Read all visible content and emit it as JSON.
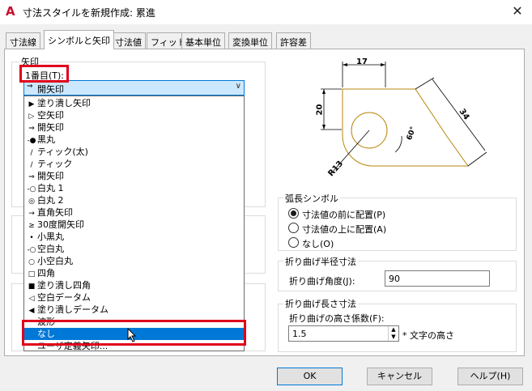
{
  "window": {
    "title": "寸法スタイルを新規作成: 累進",
    "app_icon": "A"
  },
  "tabs": [
    "寸法線",
    "シンボルと矢印",
    "寸法値",
    "フィット",
    "基本単位",
    "変換単位",
    "許容差"
  ],
  "arrows_group": {
    "label": "矢印",
    "first_label": "1番目(T):",
    "first_value": "開矢印"
  },
  "dropdown_items": [
    {
      "glyph": "▶",
      "label": "塗り潰し矢印"
    },
    {
      "glyph": "▷",
      "label": "空矢印"
    },
    {
      "glyph": "⇒",
      "label": "開矢印"
    },
    {
      "glyph": "-●",
      "label": "黒丸"
    },
    {
      "glyph": "/",
      "label": "ティック(太)"
    },
    {
      "glyph": "/",
      "label": "ティック"
    },
    {
      "glyph": "⇒",
      "label": "開矢印"
    },
    {
      "glyph": "-○",
      "label": "白丸 1"
    },
    {
      "glyph": "◎",
      "label": "白丸 2"
    },
    {
      "glyph": "→",
      "label": "直角矢印"
    },
    {
      "glyph": "≥",
      "label": "30度開矢印"
    },
    {
      "glyph": "•",
      "label": "小黒丸"
    },
    {
      "glyph": "-○",
      "label": "空白丸"
    },
    {
      "glyph": "○",
      "label": "小空白丸"
    },
    {
      "glyph": "□",
      "label": "四角"
    },
    {
      "glyph": "■",
      "label": "塗り潰し四角"
    },
    {
      "glyph": "◁",
      "label": "空白データム"
    },
    {
      "glyph": "◀",
      "label": "塗り潰しデータム"
    },
    {
      "glyph": "",
      "label": "波形"
    },
    {
      "glyph": "",
      "label": "なし"
    },
    {
      "glyph": "",
      "label": "ユーザ定義矢印..."
    }
  ],
  "dropdown_selected_index": 19,
  "drawing": {
    "dim_top": "17",
    "dim_left": "20",
    "dim_diag": "34",
    "dim_radius": "R13",
    "dim_angle": "60°"
  },
  "arc_symbol": {
    "label": "弧長シンボル",
    "options": [
      "寸法値の前に配置(P)",
      "寸法値の上に配置(A)",
      "なし(O)"
    ],
    "selected": 0
  },
  "jog_radius": {
    "label": "折り曲げ半径寸法",
    "angle_label": "折り曲げ角度(J):",
    "angle_value": "90"
  },
  "jog_linear": {
    "label": "折り曲げ長さ寸法",
    "height_label": "折り曲げの高さ係数(F):",
    "height_value": "1.5",
    "suffix": "* 文字の高さ"
  },
  "buttons": {
    "ok": "OK",
    "cancel": "キャンセル",
    "help": "ヘルプ(H)"
  },
  "colors": {
    "accent": "#0078d7",
    "highlight": "#e0001b",
    "drawing": "#b8860b"
  }
}
